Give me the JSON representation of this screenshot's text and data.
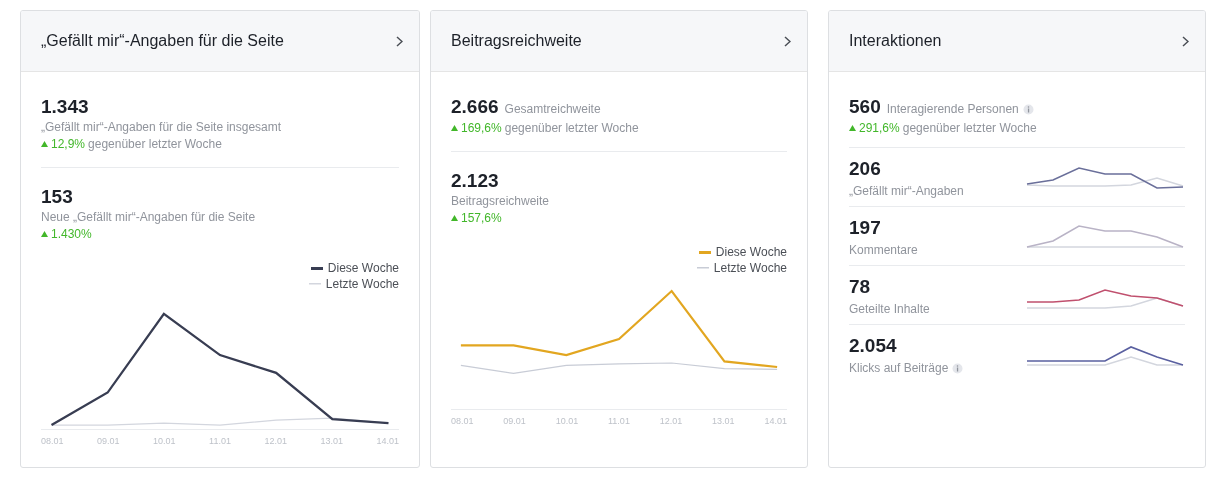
{
  "cards": [
    {
      "title": "„Gefällt mir“-Angaben für die Seite",
      "kind": "chart",
      "sections": [
        {
          "kind": "stacked",
          "value": "1.343",
          "label": "„Gefällt mir“-Angaben für die Seite insgesamt",
          "change": "12,9%",
          "change_note": "gegenüber letzter Woche"
        },
        {
          "kind": "stacked",
          "value": "153",
          "label": "Neue „Gefällt mir“-Angaben für die Seite",
          "change": "1.430%"
        }
      ],
      "legend": [
        {
          "label": "Diese Woche",
          "color": "#383d52"
        },
        {
          "label": "Letzte Woche",
          "color": "#d3d6de"
        }
      ],
      "axis_labels": [
        "08.01",
        "09.01",
        "10.01",
        "11.01",
        "12.01",
        "13.01",
        "14.01"
      ]
    },
    {
      "title": "Beitragsreichweite",
      "kind": "chart",
      "sections": [
        {
          "kind": "inline",
          "value": "2.666",
          "label": "Gesamtreichweite",
          "change": "169,6%",
          "change_note": "gegenüber letzter Woche"
        },
        {
          "kind": "stacked",
          "value": "2.123",
          "label": "Beitragsreichweite",
          "change": "157,6%"
        }
      ],
      "legend": [
        {
          "label": "Diese Woche",
          "color": "#e2a620"
        },
        {
          "label": "Letzte Woche",
          "color": "#c8ccd6"
        }
      ],
      "axis_labels": [
        "08.01",
        "09.01",
        "10.01",
        "11.01",
        "12.01",
        "13.01",
        "14.01"
      ]
    },
    {
      "title": "Interaktionen",
      "kind": "list",
      "sections": [
        {
          "kind": "inline",
          "value": "560",
          "label": "Interagierende Personen",
          "info": true,
          "change": "291,6%",
          "change_note": "gegenüber letzter Woche"
        },
        {
          "kind": "sparkline",
          "value": "206",
          "label": "„Gefällt mir“-Angaben",
          "color": "#6a6f9a"
        },
        {
          "kind": "sparkline",
          "value": "197",
          "label": "Kommentare",
          "color": "#b9b3c6"
        },
        {
          "kind": "sparkline",
          "value": "78",
          "label": "Geteilte Inhalte",
          "color": "#c0506e"
        },
        {
          "kind": "sparkline",
          "value": "2.054",
          "label": "Klicks auf Beiträge",
          "info": true,
          "color": "#5a60a0"
        }
      ]
    }
  ]
}
